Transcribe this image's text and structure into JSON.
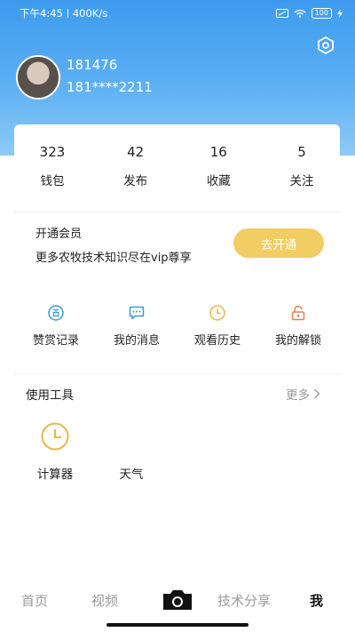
{
  "status_bar": {
    "time": "下午4:45",
    "speed": "400K/s",
    "battery": "100"
  },
  "profile": {
    "name": "181476",
    "phone": "181****2211"
  },
  "stats": [
    {
      "value": "323",
      "label": "钱包"
    },
    {
      "value": "42",
      "label": "发布"
    },
    {
      "value": "16",
      "label": "收藏"
    },
    {
      "value": "5",
      "label": "关注"
    }
  ],
  "vip": {
    "title": "开通会员",
    "desc": "更多农牧技术知识尽在vip尊享",
    "button": "去开通"
  },
  "quick_actions": [
    {
      "label": "赞赏记录",
      "icon": "reward-icon",
      "color": "#3a9bd8"
    },
    {
      "label": "我的消息",
      "icon": "message-icon",
      "color": "#3a9bd8"
    },
    {
      "label": "观看历史",
      "icon": "clock-icon",
      "color": "#e9b84a"
    },
    {
      "label": "我的解锁",
      "icon": "unlock-icon",
      "color": "#e57d4f"
    }
  ],
  "tools": {
    "title": "使用工具",
    "more": "更多",
    "items": [
      {
        "label": "计算器",
        "icon": "clock-icon",
        "color": "#e9b84a"
      },
      {
        "label": "天气"
      }
    ]
  },
  "nav": {
    "home": "首页",
    "video": "视频",
    "tech": "技术分享",
    "me": "我"
  },
  "colors": {
    "header": "#3d9bee",
    "vip_button": "#f2cd63",
    "nav_active": "#111111",
    "nav_inactive": "#999999"
  }
}
